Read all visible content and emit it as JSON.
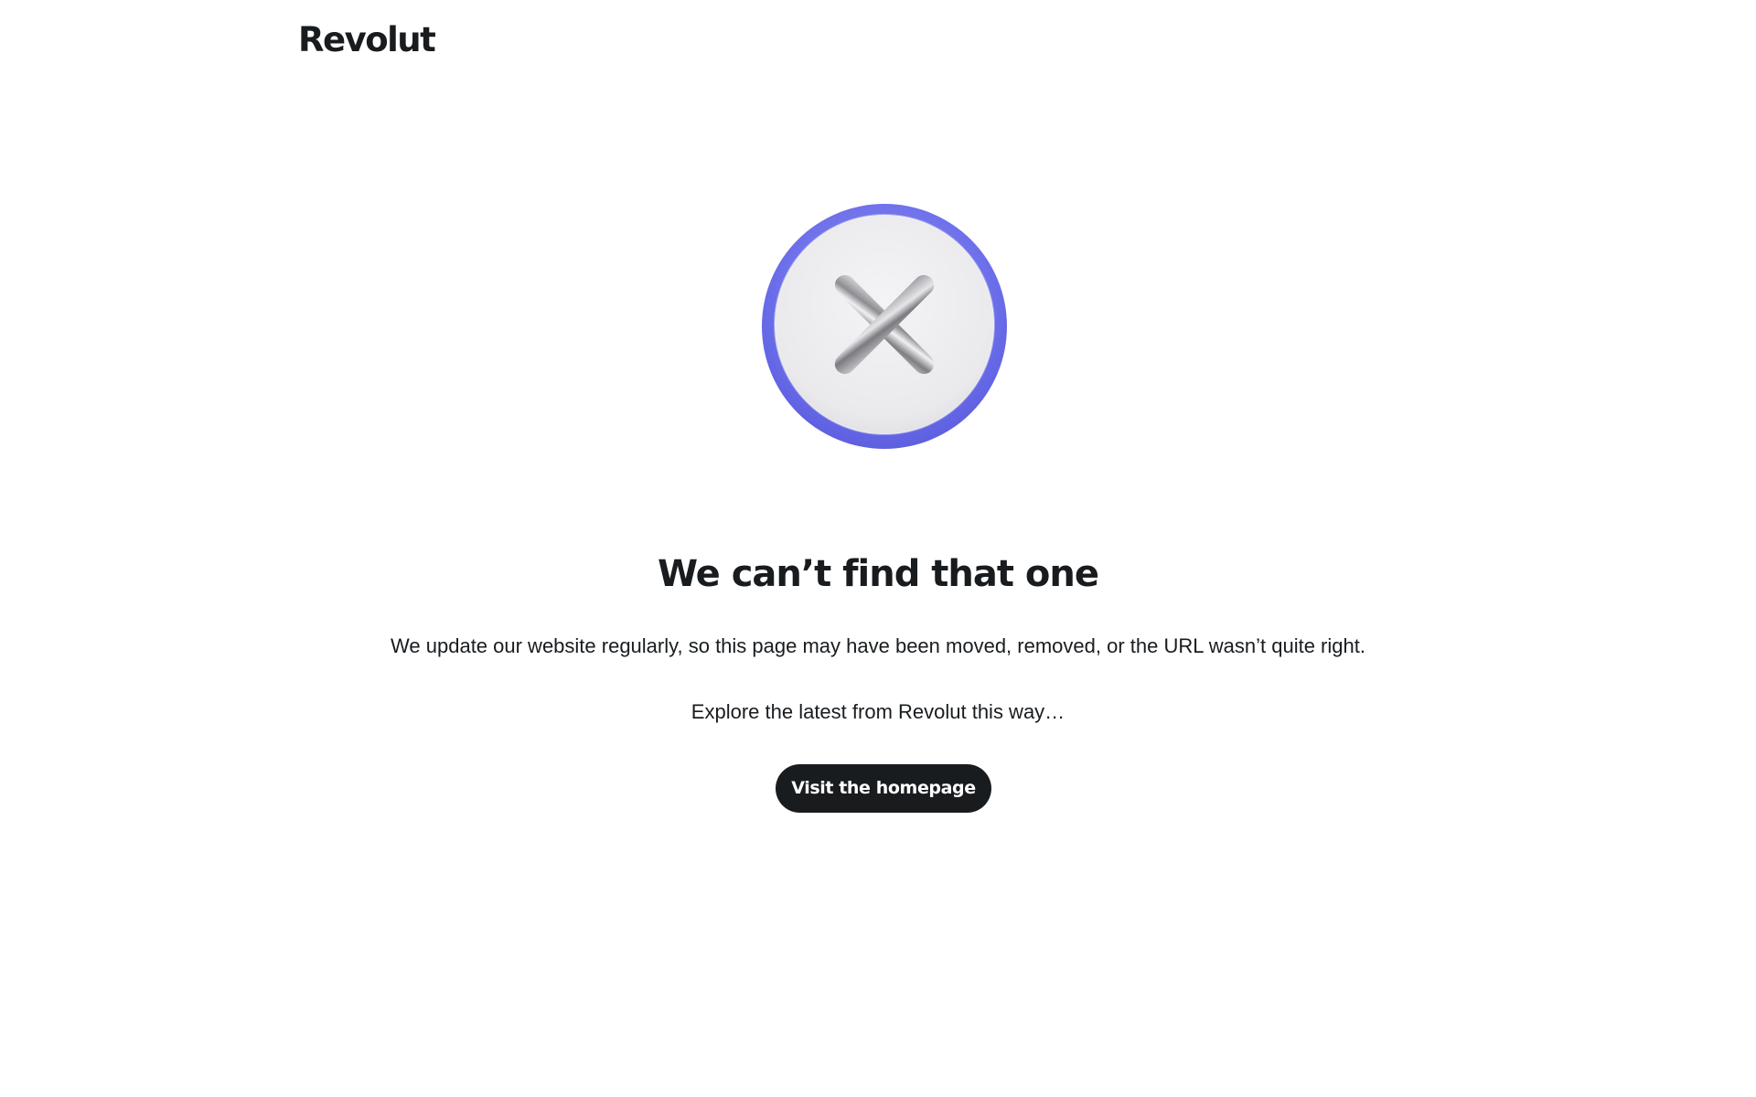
{
  "header": {
    "logo_text": "Revolut"
  },
  "main": {
    "illustration_icon": "error-x-icon",
    "title": "We can’t find that one",
    "description": "We update our website regularly, so this page may have been moved, removed, or the URL wasn’t quite right.",
    "explore_text": "Explore the latest from Revolut this way…",
    "cta_label": "Visit the homepage"
  },
  "colors": {
    "text": "#191c1f",
    "button_bg": "#191c1f",
    "button_text": "#ffffff",
    "ring_accent": "#6b6ee8",
    "background": "#ffffff"
  }
}
